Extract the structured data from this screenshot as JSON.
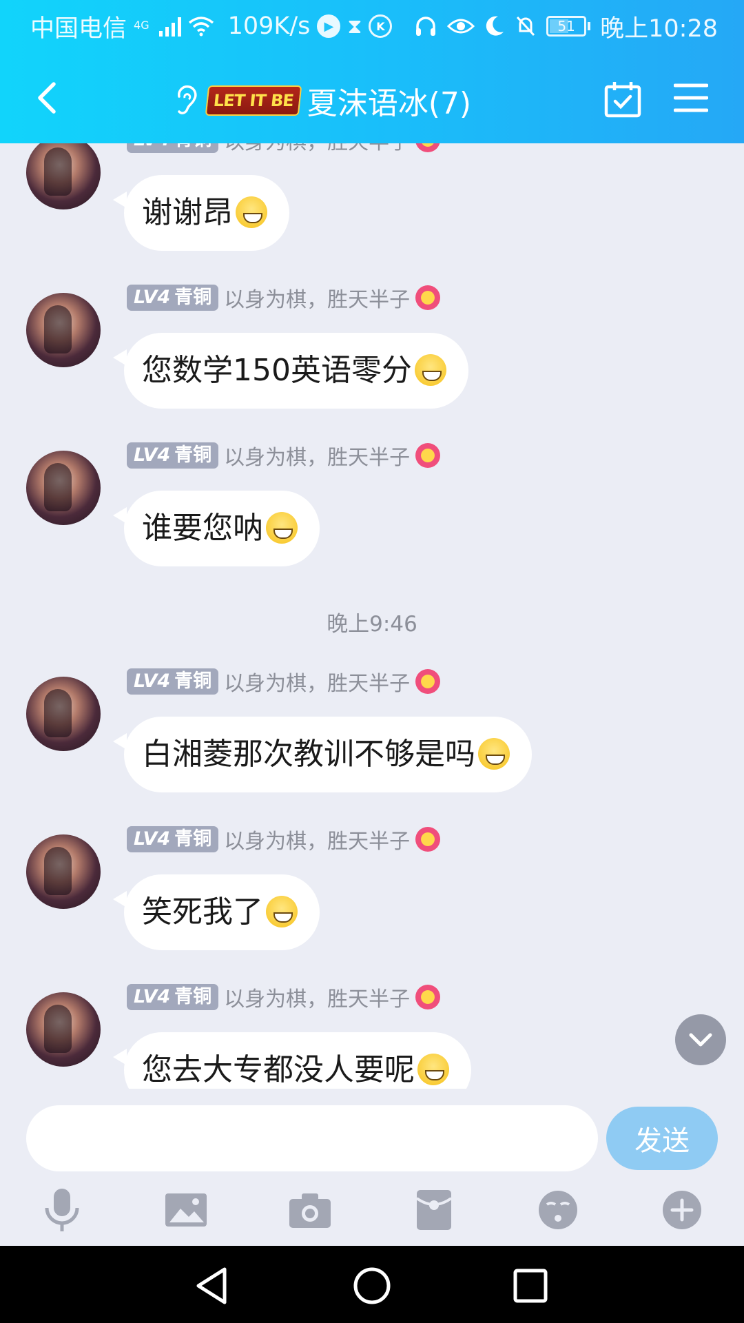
{
  "status_bar": {
    "carrier": "中国电信",
    "network": "4G",
    "speed": "109K/s",
    "battery": "51",
    "time": "晚上10:28"
  },
  "header": {
    "badge": "LET IT BE",
    "title": "夏沫语冰(7)"
  },
  "messages": [
    {
      "level_prefix": "LV4",
      "level_name": "青铜",
      "sender": "以身为棋，胜天半子",
      "text": "谢谢昂"
    },
    {
      "level_prefix": "LV4",
      "level_name": "青铜",
      "sender": "以身为棋，胜天半子",
      "text": "您数学150英语零分"
    },
    {
      "level_prefix": "LV4",
      "level_name": "青铜",
      "sender": "以身为棋，胜天半子",
      "text": "谁要您呐"
    },
    {
      "level_prefix": "LV4",
      "level_name": "青铜",
      "sender": "以身为棋，胜天半子",
      "text": "白湘菱那次教训不够是吗"
    },
    {
      "level_prefix": "LV4",
      "level_name": "青铜",
      "sender": "以身为棋，胜天半子",
      "text": "笑死我了"
    },
    {
      "level_prefix": "LV4",
      "level_name": "青铜",
      "sender": "以身为棋，胜天半子",
      "text": "您去大专都没人要呢"
    }
  ],
  "time_separator": "晚上9:46",
  "composer": {
    "input_value": "",
    "send_label": "发送"
  },
  "toolbar_icons": [
    "microphone-icon",
    "image-icon",
    "camera-icon",
    "red-packet-icon",
    "emoji-icon",
    "plus-icon"
  ],
  "colors": {
    "header_gradient_start": "#11d4fb",
    "header_gradient_end": "#25a8f6",
    "background": "#ebedf5",
    "send_button": "#8fcbf3",
    "level_badge": "#a2a8bc"
  }
}
